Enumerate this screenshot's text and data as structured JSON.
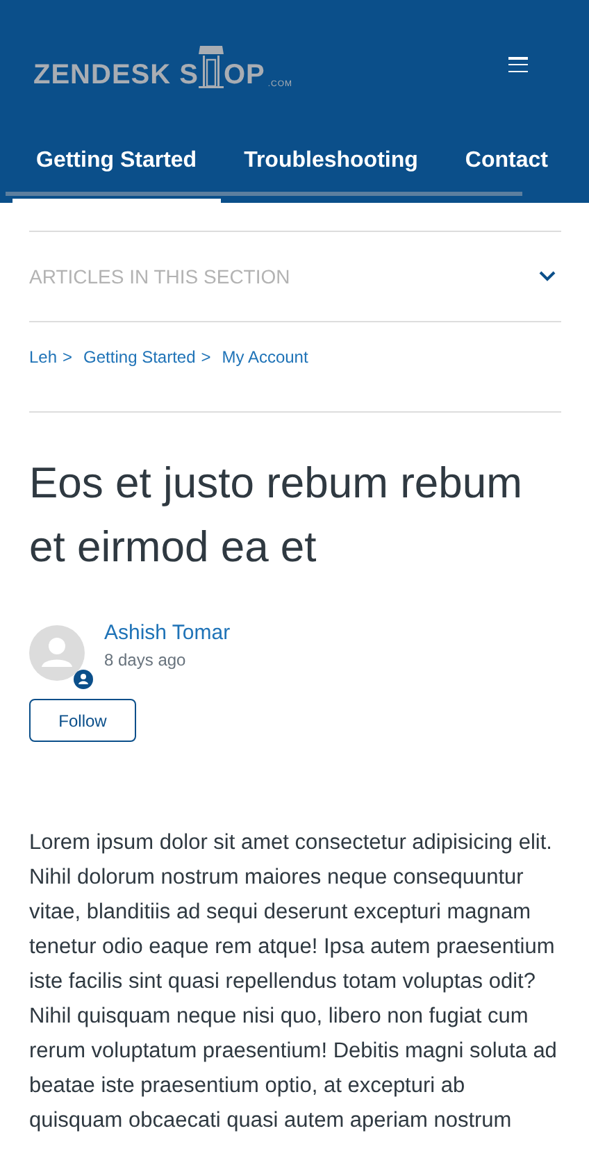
{
  "header": {
    "logo": {
      "before": "ZENDESK S",
      "after": "OP",
      "suffix": ".COM"
    }
  },
  "tabs": [
    {
      "label": "Getting Started",
      "selected": true
    },
    {
      "label": "Troubleshooting",
      "selected": false
    },
    {
      "label": "Contact",
      "selected": false
    }
  ],
  "section_toggle": {
    "label": "ARTICLES IN THIS SECTION",
    "expanded": false
  },
  "breadcrumbs": [
    {
      "label": "Leh",
      "separator": ">"
    },
    {
      "label": "Getting Started",
      "separator": ">"
    },
    {
      "label": "My Account"
    }
  ],
  "article": {
    "title": "Eos et justo rebum rebum et eirmod ea et",
    "author": "Ashish Tomar",
    "date": "8 days ago",
    "follow_button": "Follow",
    "body": "Lorem ipsum dolor sit amet consectetur adipisicing elit. Nihil dolorum nostrum maiores neque consequuntur vitae, blanditiis ad sequi deserunt excepturi magnam tenetur odio eaque rem atque! Ipsa autem praesentium iste facilis sint quasi repellendus totam voluptas odit? Nihil quisquam neque nisi quo, libero non fugiat cum rerum voluptatum praesentium! Debitis magni soluta ad beatae iste praesentium optio, at excepturi ab quisquam obcaecati quasi autem aperiam nostrum"
  }
}
